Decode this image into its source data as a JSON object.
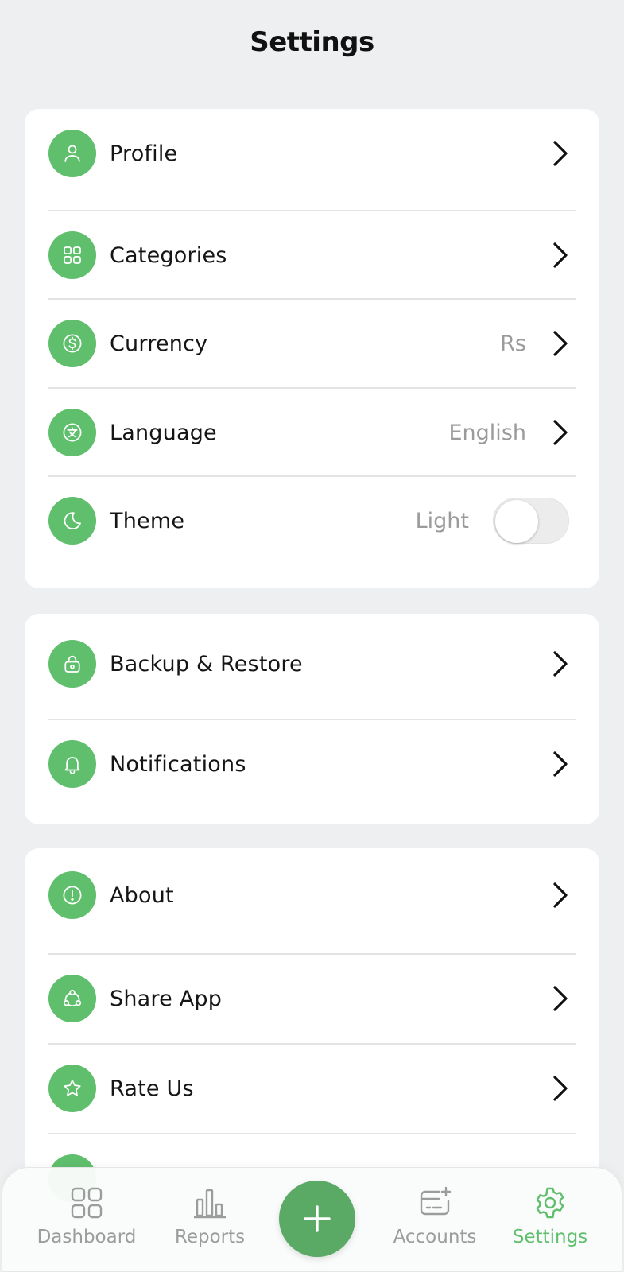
{
  "header": {
    "title": "Settings"
  },
  "colors": {
    "accent": "#5fbf6d",
    "background": "#eeeff1",
    "card": "#ffffff",
    "muted_text": "#9b9b9b"
  },
  "group1": {
    "profile": {
      "label": "Profile",
      "icon": "user-icon"
    },
    "categories": {
      "label": "Categories",
      "icon": "grid-icon"
    },
    "currency": {
      "label": "Currency",
      "value": "Rs",
      "icon": "dollar-icon"
    },
    "language": {
      "label": "Language",
      "value": "English",
      "icon": "language-icon"
    },
    "theme": {
      "label": "Theme",
      "value": "Light",
      "icon": "moon-icon",
      "dark_mode_enabled": false
    }
  },
  "group2": {
    "backup": {
      "label": "Backup & Restore",
      "icon": "lock-icon"
    },
    "notifications": {
      "label": "Notifications",
      "icon": "bell-icon"
    }
  },
  "group3": {
    "about": {
      "label": "About",
      "icon": "info-icon"
    },
    "share": {
      "label": "Share App",
      "icon": "share-icon"
    },
    "rate": {
      "label": "Rate Us",
      "icon": "star-icon"
    }
  },
  "nav": {
    "dashboard": "Dashboard",
    "reports": "Reports",
    "accounts": "Accounts",
    "settings": "Settings",
    "active": "settings"
  }
}
